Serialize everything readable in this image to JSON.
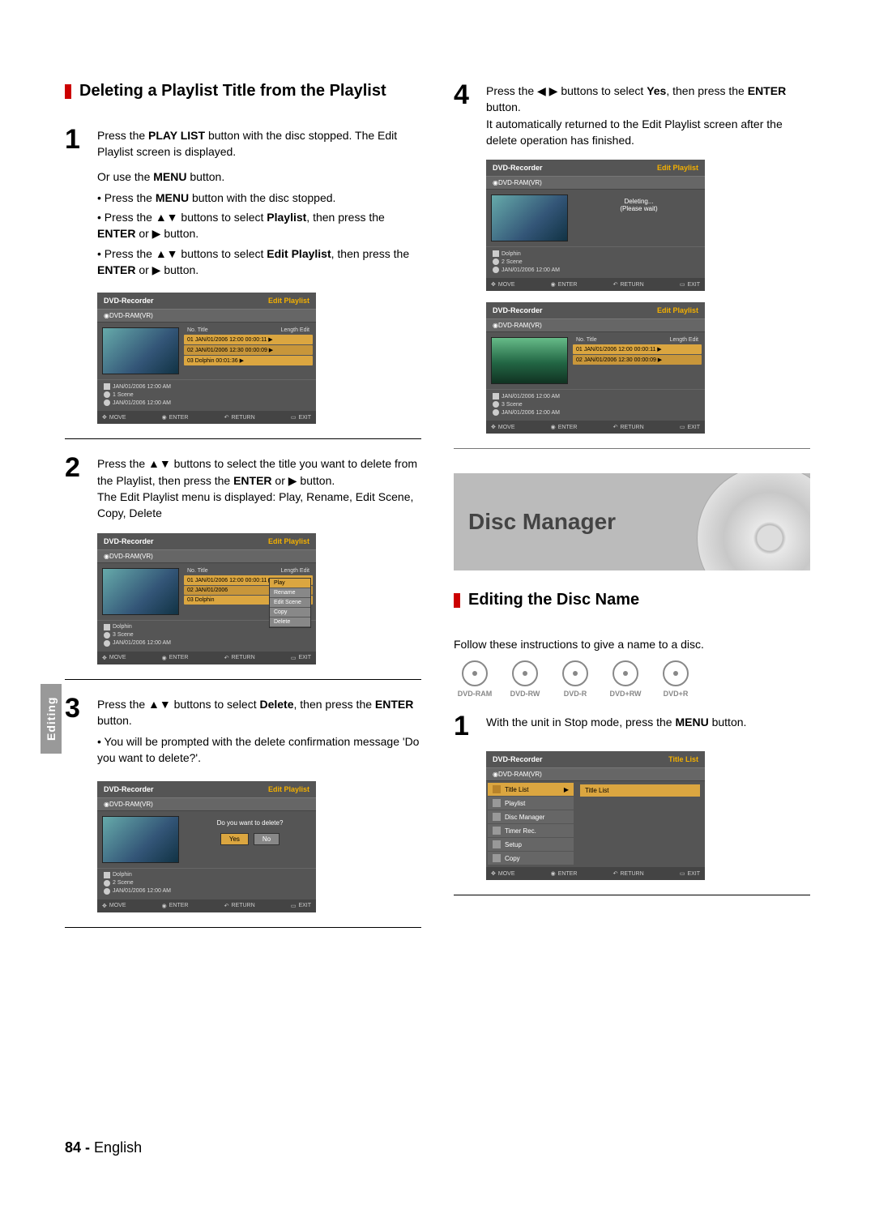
{
  "sideTab": "Editing",
  "left": {
    "heading": "Deleting a Playlist Title from the Playlist",
    "step1": {
      "num": "1",
      "line1a": "Press the ",
      "line1b": "PLAY LIST",
      "line1c": " button with the disc stopped. The Edit Playlist screen is displayed.",
      "or_a": "Or use the ",
      "or_b": "MENU",
      "or_c": " button.",
      "b1a": "• Press the ",
      "b1b": "MENU",
      "b1c": " button with the disc stopped.",
      "b2a": "• Press the ▲▼ buttons to select ",
      "b2b": "Playlist",
      "b2c": ", then press the ",
      "b2d": "ENTER",
      "b2e": " or ▶ button.",
      "b3a": "• Press the ▲▼ buttons to select ",
      "b3b": "Edit Playlist",
      "b3c": ", then press the ",
      "b3d": "ENTER",
      "b3e": " or ▶ button."
    },
    "step2": {
      "num": "2",
      "t1": "Press the ▲▼ buttons to select the title you want to delete from the Playlist, then press the ",
      "t2": "ENTER",
      "t3": " or ▶ button.",
      "t4": "The Edit Playlist menu is displayed: Play, Rename, Edit Scene, Copy, Delete"
    },
    "step3": {
      "num": "3",
      "t1": "Press the ▲▼ buttons to select ",
      "t2": "Delete",
      "t3": ", then press the ",
      "t4": "ENTER",
      "t5": " button.",
      "b1": "• You will be prompted with the delete confirmation message 'Do you want to delete?'."
    }
  },
  "right": {
    "step4": {
      "num": "4",
      "t1": "Press the ◀ ▶ buttons to select ",
      "t2": "Yes",
      "t3": ", then press the ",
      "t4": "ENTER",
      "t5": " button.",
      "t6": "It automatically returned to the Edit Playlist screen after the delete operation has finished."
    },
    "bannerTitle": "Disc Manager",
    "heading2": "Editing the Disc Name",
    "intro2": "Follow these instructions to give a name to a disc.",
    "discTypes": [
      "DVD-RAM",
      "DVD-RW",
      "DVD-R",
      "DVD+RW",
      "DVD+R"
    ],
    "step1b": {
      "num": "1",
      "t1": "With the unit in Stop mode, press the ",
      "t2": "MENU",
      "t3": " button."
    }
  },
  "screens": {
    "common": {
      "title": "DVD-Recorder",
      "editPl": "Edit Playlist",
      "titleList": "Title List",
      "sub": "DVD-RAM(VR)",
      "listHead_no": "No.  Title",
      "listHead_len": "Length  Edit",
      "move": "MOVE",
      "enter": "ENTER",
      "return": "RETURN",
      "exit": "EXIT"
    },
    "s1": {
      "rows": [
        "01 JAN/01/2006  12:00   00:00:11  ▶",
        "02 JAN/01/2006  12:30   00:00:09  ▶",
        "03 Dolphin                  00:01:36  ▶"
      ],
      "meta": [
        "JAN/01/2006 12:00 AM",
        "1 Scene",
        "JAN/01/2006 12:00 AM"
      ]
    },
    "s2": {
      "rows": [
        "01 JAN/01/2006  12:00   00:00:11  ▶",
        "02 JAN/01/2006",
        "03 Dolphin"
      ],
      "ctx": [
        "Play",
        "Rename",
        "Edit Scene",
        "Copy",
        "Delete"
      ],
      "meta": [
        "Dolphin",
        "3 Scene",
        "JAN/01/2006 12:00 AM"
      ]
    },
    "s3": {
      "msg": "Do you want to delete?",
      "yes": "Yes",
      "no": "No",
      "meta": [
        "Dolphin",
        "2 Scene",
        "JAN/01/2006 12:00 AM"
      ]
    },
    "s4a": {
      "msg1": "Deleting...",
      "msg2": "(Please wait)",
      "meta": [
        "Dolphin",
        "2 Scene",
        "JAN/01/2006 12:00 AM"
      ]
    },
    "s4b": {
      "rows": [
        "01 JAN/01/2006  12:00   00:00:11  ▶",
        "02 JAN/01/2006  12:30   00:00:09  ▶"
      ],
      "meta": [
        "JAN/01/2006 12:00 AM",
        "3 Scene",
        "JAN/01/2006 12:00 AM"
      ]
    },
    "menu": {
      "items": [
        "Title List",
        "Playlist",
        "Disc Manager",
        "Timer Rec.",
        "Setup",
        "Copy"
      ],
      "sel": "Title List"
    }
  },
  "footer": {
    "page": "84 -",
    "lang": "English"
  }
}
